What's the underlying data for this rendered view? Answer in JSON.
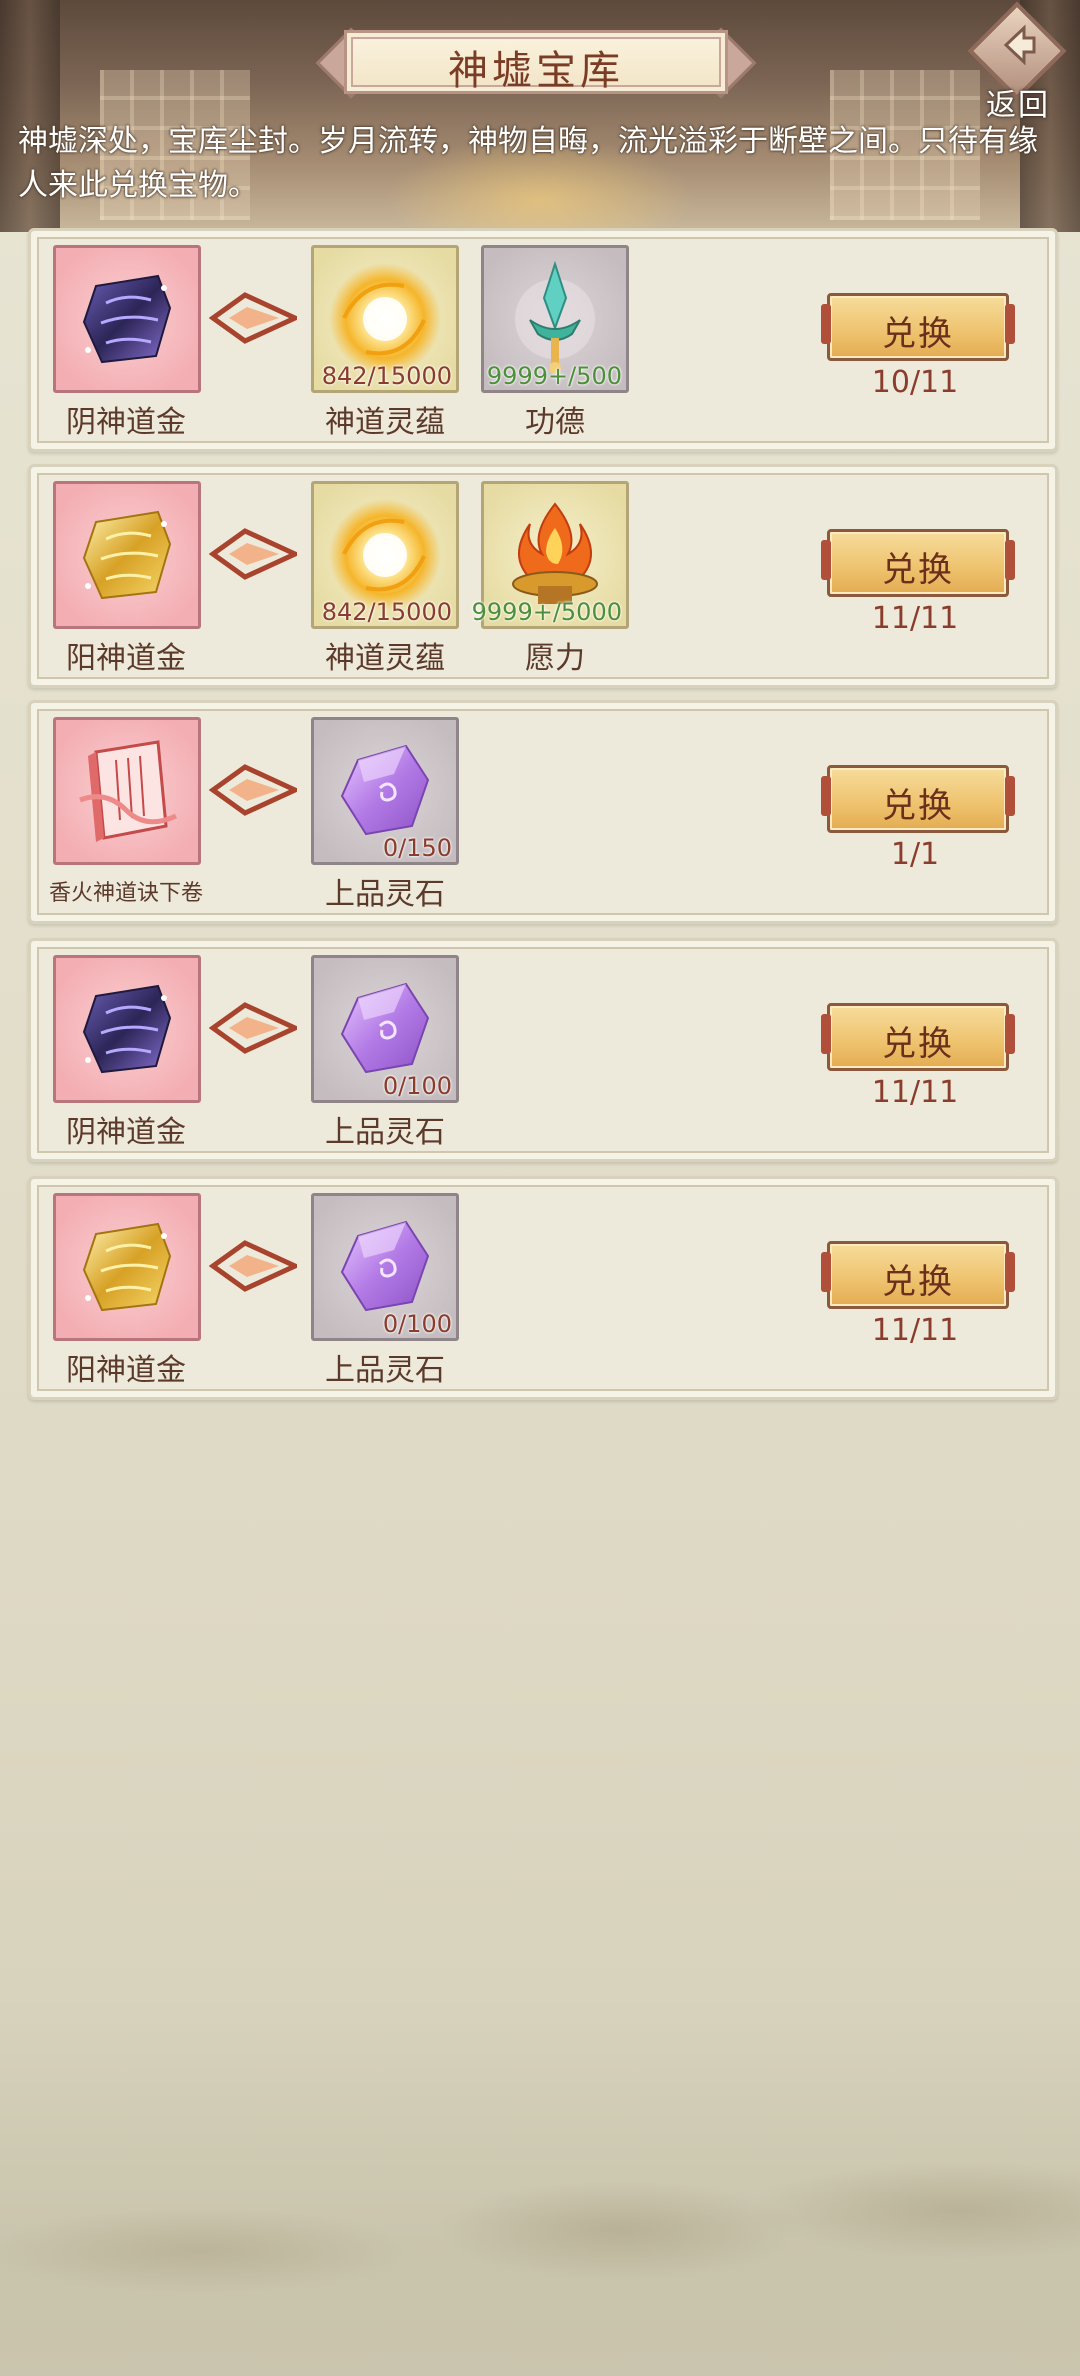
{
  "header": {
    "title": "神墟宝库",
    "back_label": "返回",
    "description": "神墟深处，宝库尘封。岁月流转，神物自晦，流光溢彩于断壁之间。只待有缘人来此兑换宝物。"
  },
  "exchanges": [
    {
      "reward": {
        "name": "阴神道金",
        "icon": "dark-gold-ore-icon"
      },
      "costs": [
        {
          "name": "神道灵蕴",
          "count": "842/15000",
          "icon": "golden-orb-icon"
        },
        {
          "name": "功德",
          "count": "9999+/500",
          "icon": "jade-sword-icon"
        }
      ],
      "button_label": "兑换",
      "limit": "10/11"
    },
    {
      "reward": {
        "name": "阳神道金",
        "icon": "bright-gold-ore-icon"
      },
      "costs": [
        {
          "name": "神道灵蕴",
          "count": "842/15000",
          "icon": "golden-orb-icon"
        },
        {
          "name": "愿力",
          "count": "9999+/5000",
          "icon": "flame-altar-icon"
        }
      ],
      "button_label": "兑换",
      "limit": "11/11"
    },
    {
      "reward": {
        "name": "香火神道诀下卷",
        "icon": "scroll-book-icon"
      },
      "costs": [
        {
          "name": "上品灵石",
          "count": "0/150",
          "icon": "purple-spirit-stone-icon"
        }
      ],
      "button_label": "兑换",
      "limit": "1/1"
    },
    {
      "reward": {
        "name": "阴神道金",
        "icon": "dark-gold-ore-icon"
      },
      "costs": [
        {
          "name": "上品灵石",
          "count": "0/100",
          "icon": "purple-spirit-stone-icon"
        }
      ],
      "button_label": "兑换",
      "limit": "11/11"
    },
    {
      "reward": {
        "name": "阳神道金",
        "icon": "bright-gold-ore-icon"
      },
      "costs": [
        {
          "name": "上品灵石",
          "count": "0/100",
          "icon": "purple-spirit-stone-icon"
        }
      ],
      "button_label": "兑换",
      "limit": "11/11"
    }
  ]
}
